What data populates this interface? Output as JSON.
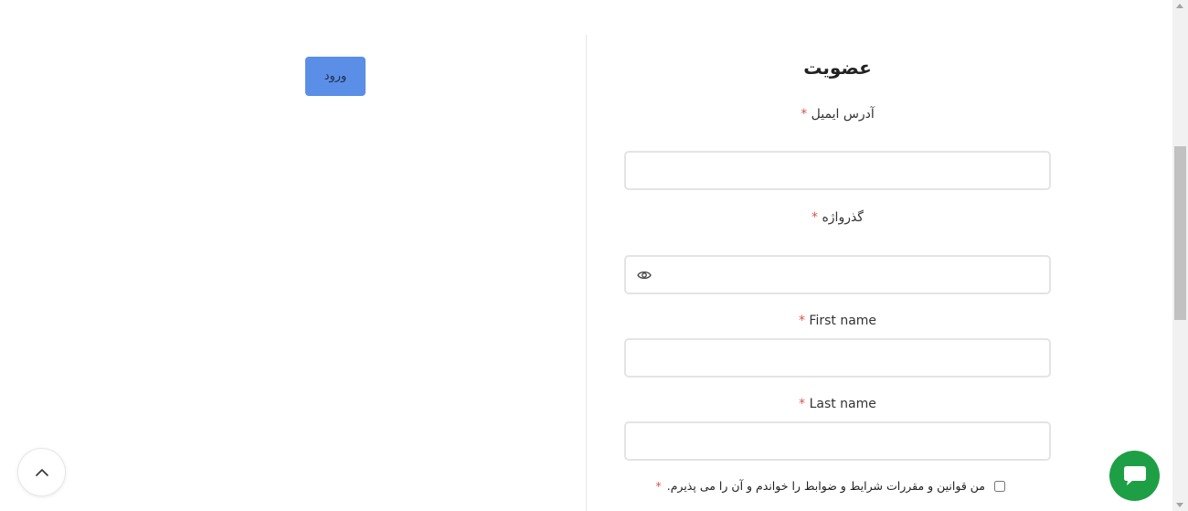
{
  "login": {
    "button_label": "ورود"
  },
  "register": {
    "title": "عضویت",
    "required_mark": "*",
    "email": {
      "label": "آدرس ایمیل",
      "value": "",
      "placeholder": ""
    },
    "password": {
      "label": "گذرواژه",
      "value": "",
      "placeholder": ""
    },
    "first_name": {
      "label": "First name",
      "value": "",
      "placeholder": ""
    },
    "last_name": {
      "label": "Last name",
      "value": "",
      "placeholder": ""
    },
    "terms": {
      "label": "من قوانین و مقررات شرایط و ضوابط را خواندم و آن را می پذیرم.",
      "checked": false
    }
  },
  "icons": {
    "password_toggle": "eye-icon",
    "scroll_top": "chevron-up-icon",
    "chat": "chat-bubble-icon"
  },
  "colors": {
    "login_button": "#5b8ee6",
    "required": "#d9534f",
    "chat_button": "#1f9f45",
    "input_border": "#e4e4e4"
  }
}
